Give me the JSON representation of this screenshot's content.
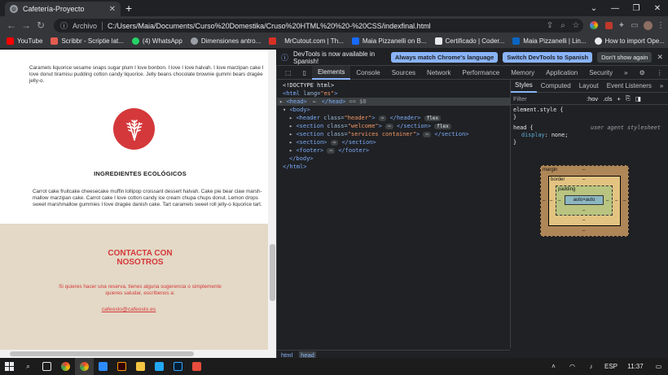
{
  "window": {
    "tab_title": "Cafetería-Proyecto",
    "new_tab": "+",
    "controls": {
      "collapse": "⌄",
      "minimize": "—",
      "maximize": "❐",
      "close": "✕"
    }
  },
  "address_bar": {
    "scheme_label": "Archivo",
    "url": "C:/Users/Maia/Documents/Curso%20Domestika/Cruso%20HTML%20%20-%20CSS/indexfinal.html"
  },
  "bookmarks": [
    {
      "label": "YouTube",
      "color": "#ff0000"
    },
    {
      "label": "Scribbr - Scriptie lat...",
      "color": "#e65c4f"
    },
    {
      "label": "(4) WhatsApp",
      "color": "#25d366"
    },
    {
      "label": "Dimensiones antro...",
      "color": "#9aa0a6"
    },
    {
      "label": "",
      "color": "#d93025"
    },
    {
      "label": "MrCutout.com | Th...",
      "color": "#202124"
    },
    {
      "label": "Maia Pizzanelli on B...",
      "color": "#1769ff"
    },
    {
      "label": "Certificado | Coder...",
      "color": "#e8eaed"
    },
    {
      "label": "Maia Pizzanelli | Lin...",
      "color": "#0a66c2"
    },
    {
      "label": "How to import Ope...",
      "color": "#e8eaed"
    }
  ],
  "page": {
    "intro_text": "Caramels liquorice sesame snaps sugar plum I love bonbon. I love I love halvah. I love marzipan cake I love donut tiramisu pudding cotton candy liquorice. Jelly beans chocolate brownie gummi bears dragée jelly-o.",
    "eco_heading": "INGREDIENTES ECOLÓGICOS",
    "eco_text": "Carrot cake fruitcake cheesecake muffin lollipop croissant dessert halvah. Cake pie bear claw marsh- mallow marzipan cake. Carrot cake I love cotton candy ice cream chupa chups donut. Lemon drops sweet marshmallow gummies I love dragée danish cake. Tart caramels sweet roll jelly-o liquorice tart.",
    "contact_title_1": "CONTACTA CON",
    "contact_title_2": "NOSOTROS",
    "contact_text": "Si quieres hacer una reserva, tienes alguna sugerencia o simplemente quieres saludar, escríbenos a:",
    "contact_email": "cafeoslo@cafeoslo.es",
    "colors": {
      "accent": "#d5383a",
      "contact_bg": "#e3d9c6"
    }
  },
  "devtools": {
    "banner_text": "DevTools is now available in Spanish!",
    "banner_btn_match": "Always match Chrome's language",
    "banner_btn_switch": "Switch DevTools to Spanish",
    "banner_btn_dismiss": "Don't show again",
    "tabs": [
      "Elements",
      "Console",
      "Sources",
      "Network",
      "Performance",
      "Memory",
      "Application",
      "Security"
    ],
    "more_tabs": "»",
    "dom": {
      "doctype": "<!DOCTYPE html>",
      "html_open_tag": "html",
      "html_lang_attr": "lang",
      "html_lang_val": "\"es\"",
      "head_line": "<head>",
      "head_ellipsis": "⋯",
      "head_close": "</head>",
      "head_eq": "== $0",
      "body_open": "<body>",
      "header_tag": "header",
      "header_class_attr": "class",
      "header_class_val": "\"header\"",
      "header_close": "</header>",
      "header_pill": "flex",
      "welcome_tag": "section",
      "welcome_class_val": "\"welcome\"",
      "welcome_close": "</section>",
      "welcome_pill": "flex",
      "services_tag": "section",
      "services_class_val": "\"services container\"",
      "services_close": "</section>",
      "plain_section_open": "<section>",
      "plain_section_close": "</section>",
      "footer_open": "<footer>",
      "footer_close": "</footer>",
      "body_close": "</body>",
      "html_close": "</html>"
    },
    "breadcrumbs": [
      "html",
      "head"
    ],
    "styles_tabs": [
      "Styles",
      "Computed",
      "Layout",
      "Event Listeners"
    ],
    "styles_more": "»",
    "filter_placeholder": "Filter",
    "hov_label": ":hov",
    "cls_label": ".cls",
    "rules": {
      "element_style": "element.style {",
      "close_brace": "}",
      "head_selector": "head {",
      "ua_label": "user agent stylesheet",
      "prop_name": "display",
      "prop_value": "none;"
    },
    "box_model": {
      "margin_label": "margin",
      "border_label": "border",
      "padding_label": "padding",
      "content_label": "auto×auto",
      "dash": "–"
    }
  },
  "taskbar": {
    "language": "ESP",
    "time": "11:37"
  }
}
